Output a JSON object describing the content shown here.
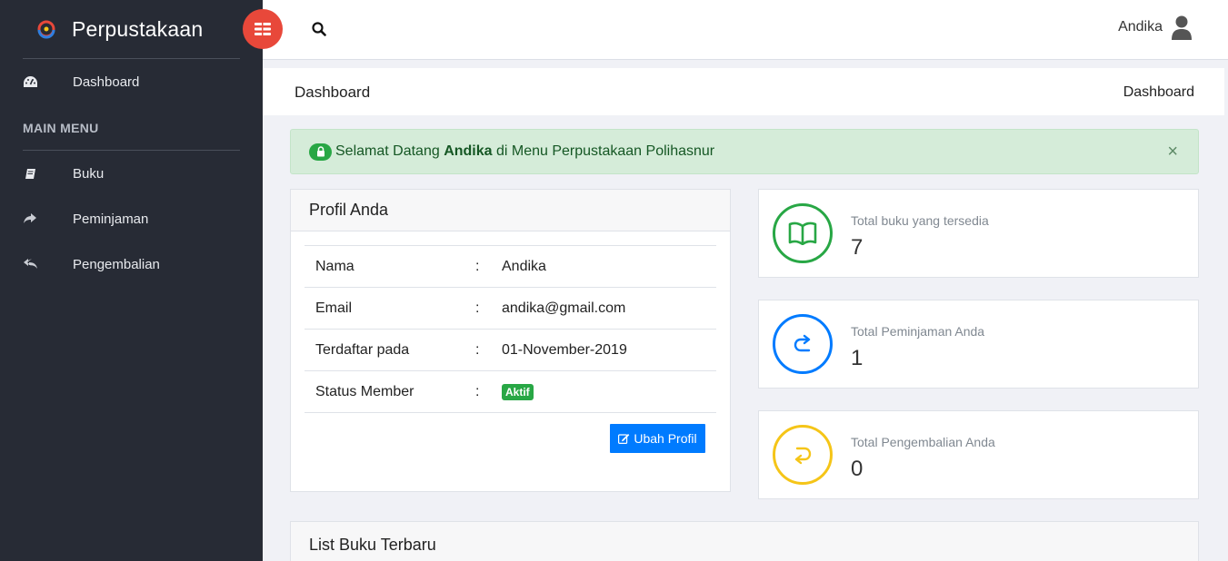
{
  "app": {
    "brand": "Perpustakaan"
  },
  "sidebar": {
    "dashboard_label": "Dashboard",
    "menu_header": "MAIN MENU",
    "items": [
      {
        "label": "Buku",
        "icon": "book-icon"
      },
      {
        "label": "Peminjaman",
        "icon": "share-icon"
      },
      {
        "label": "Pengembalian",
        "icon": "reply-icon"
      }
    ]
  },
  "topbar": {
    "user_name": "Andika"
  },
  "page": {
    "title": "Dashboard",
    "breadcrumb": "Dashboard"
  },
  "alert": {
    "prefix": "Selamat Datang ",
    "name": "Andika",
    "suffix": " di Menu Perpustakaan Polihasnur",
    "close": "×"
  },
  "profile": {
    "title": "Profil Anda",
    "rows": [
      {
        "key": "Nama",
        "sep": ":",
        "value": "Andika"
      },
      {
        "key": "Email",
        "sep": ":",
        "value": "andika@gmail.com"
      },
      {
        "key": "Terdaftar pada",
        "sep": ":",
        "value": "01-November-2019"
      },
      {
        "key": "Status Member",
        "sep": ":",
        "value": "Aktif"
      }
    ],
    "edit_button": "Ubah Profil"
  },
  "stats": [
    {
      "label": "Total buku yang tersedia",
      "value": "7",
      "color": "#28a745"
    },
    {
      "label": "Total Peminjaman Anda",
      "value": "1",
      "color": "#007bff"
    },
    {
      "label": "Total Pengembalian Anda",
      "value": "0",
      "color": "#f5c518"
    }
  ],
  "latest": {
    "title": "List Buku Terbaru"
  },
  "colors": {
    "sidebar": "#272b35",
    "toggle": "#e8483a",
    "primary": "#007bff",
    "success": "#28a745"
  }
}
